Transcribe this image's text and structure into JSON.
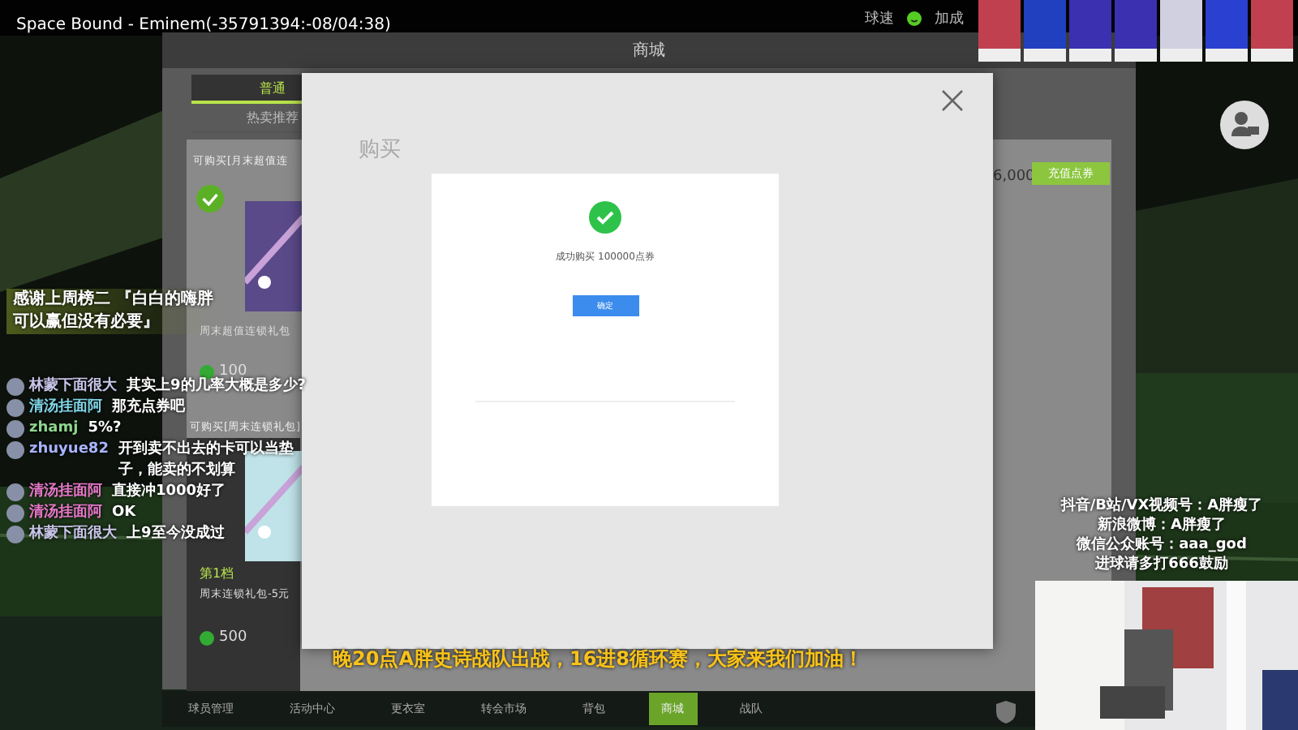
{
  "now_playing": "Space Bound - Eminem(-35791394:-08/04:38)",
  "top_bar": {
    "labels": [
      "球速",
      "加成"
    ]
  },
  "shop": {
    "title": "商城",
    "tabs": [
      {
        "label": "普通",
        "selected": true
      },
      {
        "label": "热卖推荐",
        "selected": false
      }
    ],
    "balance": "6,000",
    "recharge_button": "充值点券",
    "section_1": "可购买[月末超值连",
    "section_2": "可购买[周末连锁礼包]",
    "tier": "第1档",
    "items": [
      {
        "name": "周末超值连锁礼包",
        "price": "100"
      },
      {
        "name": "周末连锁礼包-5元",
        "price": "500"
      }
    ],
    "modal": {
      "title": "购买",
      "message": "成功购买 100000点券",
      "button": "确定"
    }
  },
  "nav": [
    {
      "label": "球员管理",
      "selected": false
    },
    {
      "label": "活动中心",
      "selected": false
    },
    {
      "label": "更衣室",
      "selected": false
    },
    {
      "label": "转会市场",
      "selected": false
    },
    {
      "label": "背包",
      "selected": false
    },
    {
      "label": "商城",
      "selected": true
    },
    {
      "label": "战队",
      "selected": false
    }
  ],
  "gift_banner": [
    "感谢上周榜二 『白白的嗨胖",
    "可以赢但没有必要』"
  ],
  "chat": [
    {
      "user": "林蒙下面很大",
      "color": "#c8c4e8",
      "text": "其实上9的几率大概是多少?"
    },
    {
      "user": "清汤挂面阿",
      "color": "#7fd4e6",
      "text": "那充点券吧"
    },
    {
      "user": "zhamj",
      "color": "#8fd68f",
      "text": "5%?"
    },
    {
      "user": "zhuyue82",
      "color": "#a8b4ff",
      "text": "开到卖不出去的卡可以当垫子，能卖的不划算"
    },
    {
      "user": "清汤挂面阿",
      "color": "#e676c8",
      "text": "直接冲1000好了"
    },
    {
      "user": "清汤挂面阿",
      "color": "#e676c8",
      "text": "OK"
    },
    {
      "user": "林蒙下面很大",
      "color": "#c8c4e8",
      "text": "上9至今没成过"
    }
  ],
  "socials": [
    "抖音/B站/VX视频号：A胖瘦了",
    "新浪微博：A胖瘦了",
    "微信公众账号：aaa_god",
    "进球请多打666鼓励"
  ],
  "ticker": "晚20点A胖史诗战队出战，16进8循环赛，大家来我们加油！"
}
